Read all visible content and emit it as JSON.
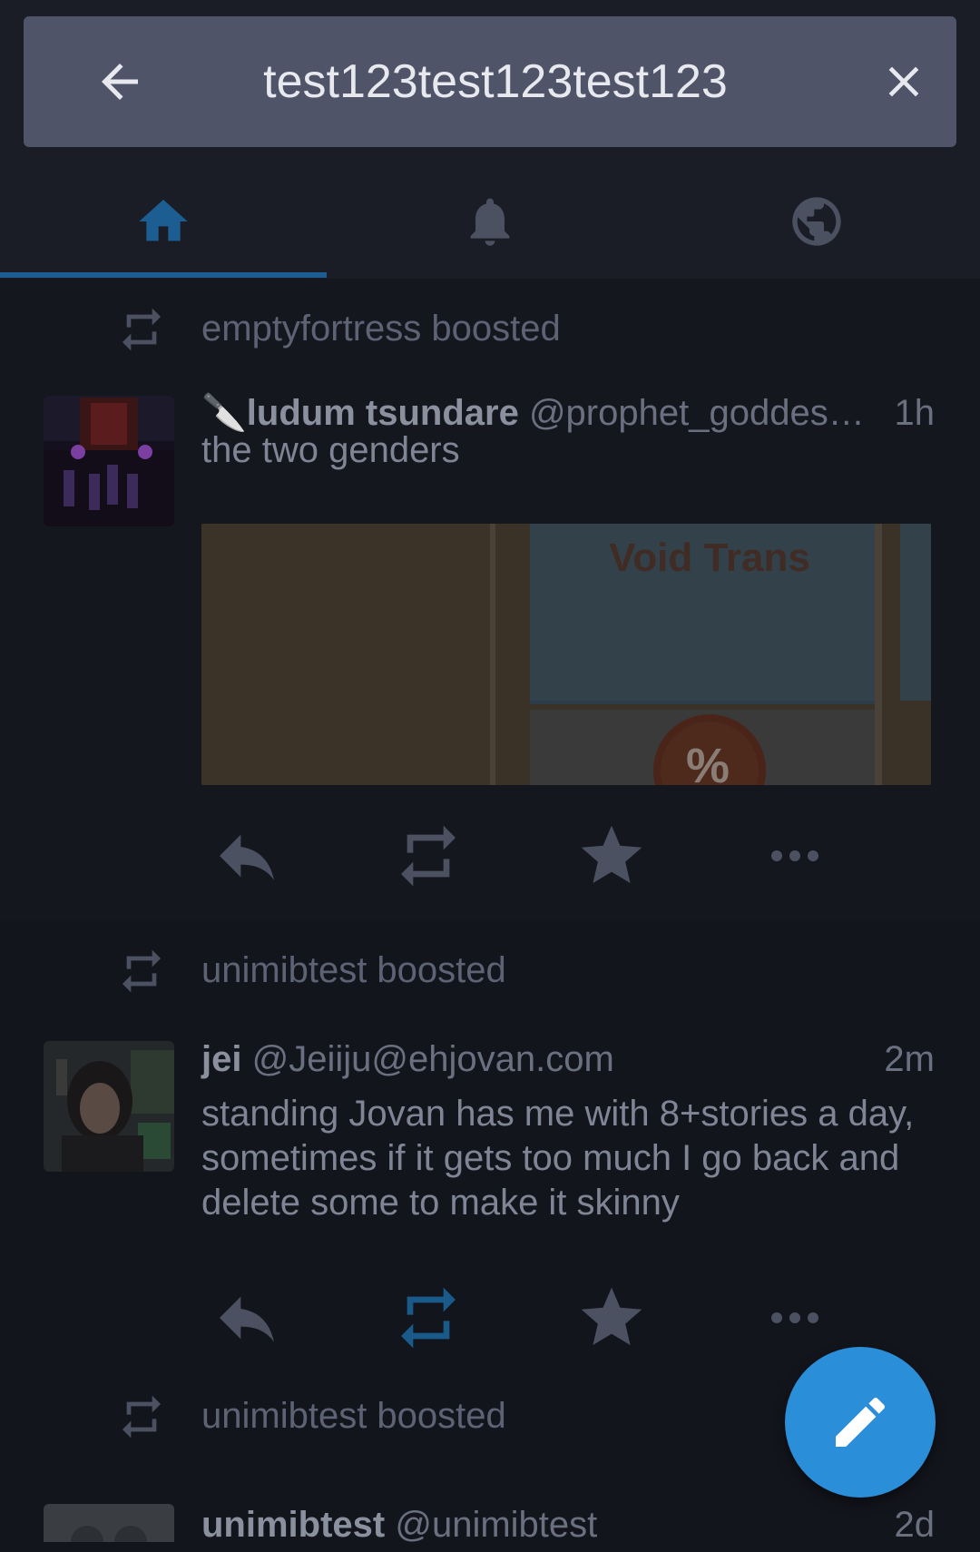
{
  "search": {
    "value": "test123test123test123"
  },
  "tabs": [
    {
      "name": "home",
      "icon": "home-icon",
      "active": true
    },
    {
      "name": "notifications",
      "icon": "bell-icon",
      "active": false
    },
    {
      "name": "public",
      "icon": "globe-icon",
      "active": false
    }
  ],
  "colors": {
    "accent": "#1d5e92",
    "fab": "#2b8ed9",
    "boosted_active": "#1a5a8a"
  },
  "statuses": [
    {
      "boosted_by": "emptyfortress boosted",
      "display_name": "🔪ludum tsundare",
      "acct": "@prophet_goddes…",
      "time": "1h",
      "content": "the two genders",
      "media_text": "Void Trans",
      "media_text2": "%"
    },
    {
      "boosted_by": "unimibtest boosted",
      "display_name": "jei",
      "acct": "@Jeiiju@ehjovan.com",
      "time": "2m",
      "content": "standing Jovan has me with 8+stories a day, sometimes if it gets too much I go back and delete some to make it skinny"
    },
    {
      "boosted_by": "unimibtest boosted",
      "display_name": "unimibtest",
      "acct": "@unimibtest",
      "time": "2d"
    }
  ]
}
